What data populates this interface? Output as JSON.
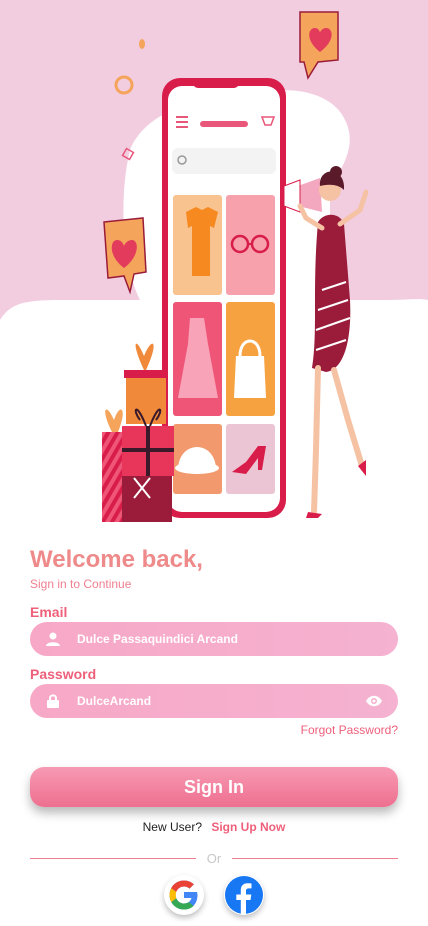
{
  "greeting": {
    "title": "Welcome back,",
    "subtitle": "Sign in to Continue"
  },
  "email": {
    "label": "Email",
    "value": "Dulce Passaquindici Arcand",
    "icon": "user-icon"
  },
  "password": {
    "label": "Password",
    "value": "DulceArcand",
    "icon": "lock-icon",
    "toggle_icon": "eye-icon"
  },
  "forgot_password": "Forgot Password?",
  "sign_in_button": "Sign In",
  "signup_prompt": {
    "text": "New User?",
    "link": "Sign Up Now"
  },
  "divider_text": "Or",
  "social": [
    {
      "name": "Google",
      "icon": "google-icon"
    },
    {
      "name": "Facebook",
      "icon": "facebook-icon"
    }
  ],
  "colors": {
    "accent": "#ee5f7a",
    "field_bg": "#f7a8c6",
    "hero_bg": "#f2cde0"
  }
}
